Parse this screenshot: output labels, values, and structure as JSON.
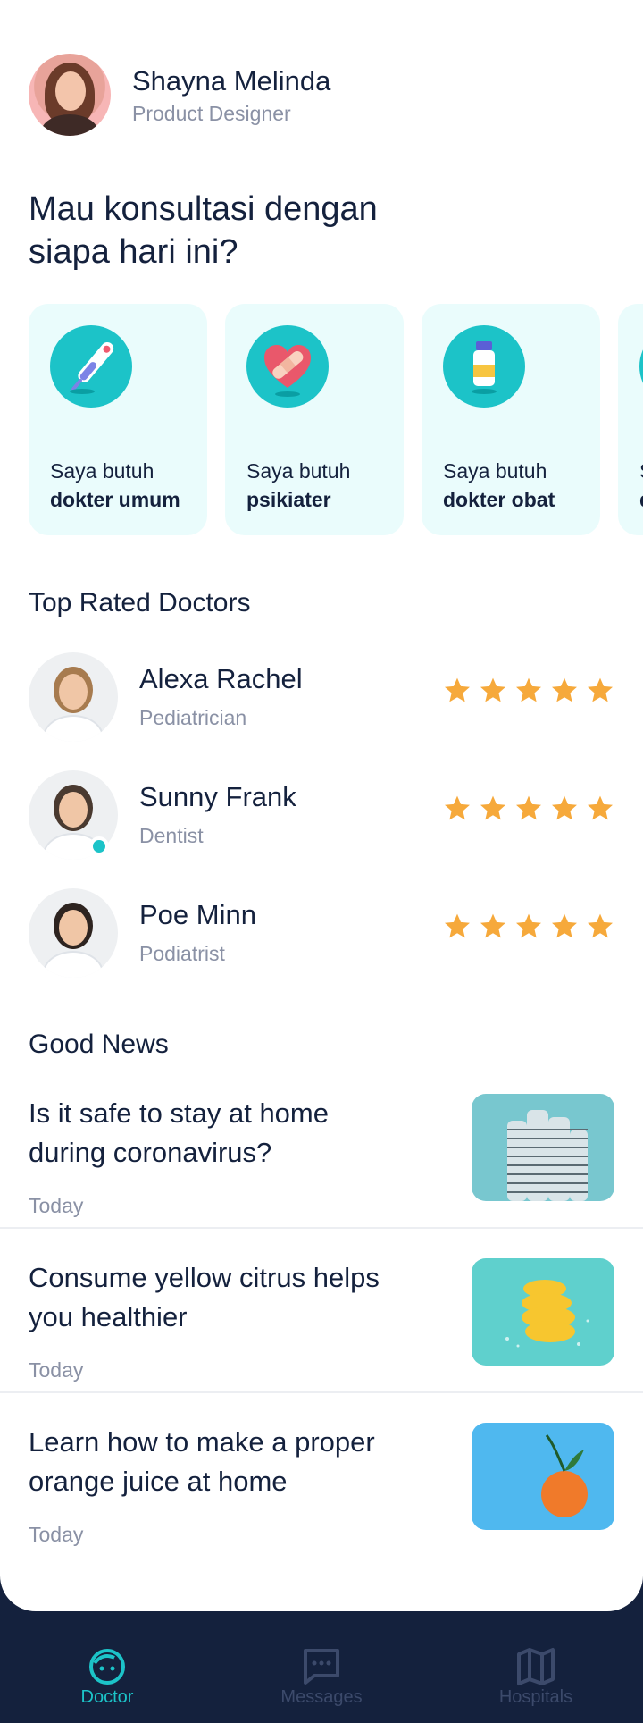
{
  "user": {
    "name": "Shayna Melinda",
    "role": "Product Designer"
  },
  "headline": "Mau konsultasi dengan siapa hari ini?",
  "categories": [
    {
      "line1": "Saya butuh",
      "line2": "dokter umum",
      "icon": "thermometer-icon"
    },
    {
      "line1": "Saya butuh",
      "line2": "psikiater",
      "icon": "bandaged-heart-icon"
    },
    {
      "line1": "Saya butuh",
      "line2": "dokter obat",
      "icon": "medicine-bottle-icon"
    },
    {
      "line1": "S",
      "line2": "d",
      "icon": "category-icon"
    }
  ],
  "top_rated": {
    "title": "Top Rated Doctors",
    "doctors": [
      {
        "name": "Alexa Rachel",
        "specialty": "Pediatrician",
        "rating": 5,
        "online": false
      },
      {
        "name": "Sunny Frank",
        "specialty": "Dentist",
        "rating": 5,
        "online": true
      },
      {
        "name": "Poe Minn",
        "specialty": "Podiatrist",
        "rating": 5,
        "online": false
      }
    ]
  },
  "news": {
    "title": "Good News",
    "items": [
      {
        "title": "Is it safe to stay at home during coronavirus?",
        "date": "Today",
        "image": "building-photo"
      },
      {
        "title": "Consume yellow citrus helps you healthier",
        "date": "Today",
        "image": "lemon-photo"
      },
      {
        "title": "Learn how to make a proper orange juice at home",
        "date": "Today",
        "image": "orange-photo"
      }
    ]
  },
  "nav": {
    "doctor": "Doctor",
    "messages": "Messages",
    "hospitals": "Hospitals"
  },
  "colors": {
    "accent": "#1cc3c8",
    "navy": "#14213d",
    "star": "#f6a93b",
    "muted": "#8a91a5"
  }
}
